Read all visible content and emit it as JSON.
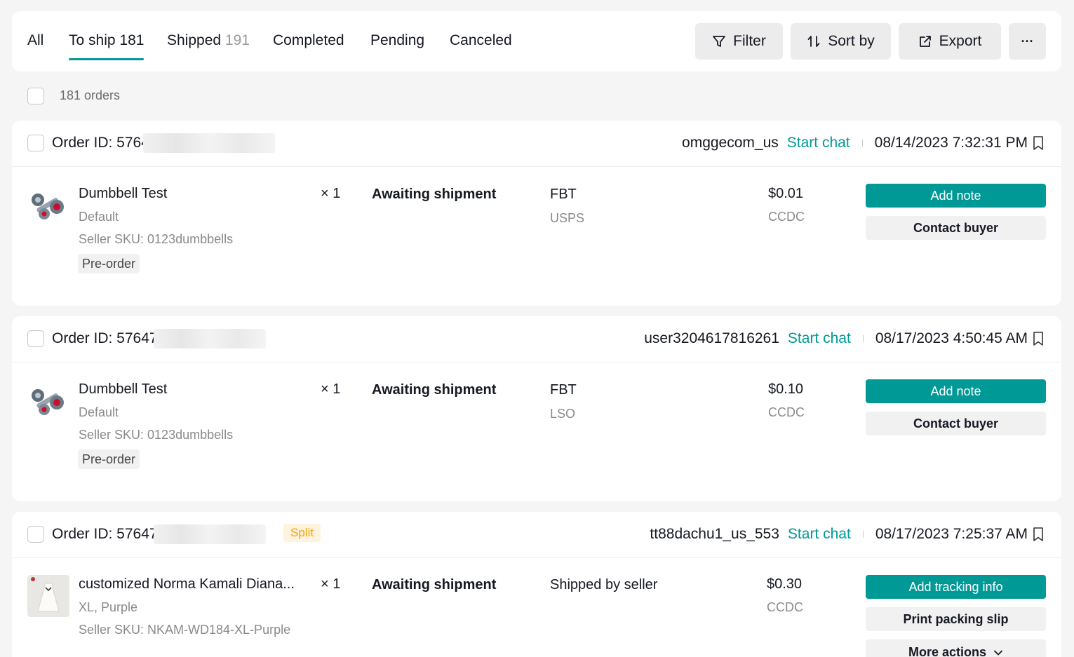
{
  "tabs": [
    {
      "label": "All",
      "count": ""
    },
    {
      "label": "To ship",
      "count": "181"
    },
    {
      "label": "Shipped",
      "count": "191"
    },
    {
      "label": "Completed",
      "count": ""
    },
    {
      "label": "Pending",
      "count": ""
    },
    {
      "label": "Canceled",
      "count": ""
    }
  ],
  "toolbar": {
    "filter_label": "Filter",
    "sort_label": "Sort by",
    "export_label": "Export",
    "more_label": "···"
  },
  "selection": {
    "orders_count": "181 orders"
  },
  "orders": [
    {
      "order_id": "Order ID: 5764",
      "buyer": "omggecom_us",
      "chat_label": "Start chat",
      "datetime": "08/14/2023 7:32:31 PM",
      "badge": "",
      "product": {
        "name": "Dumbbell Test",
        "variant": "Default",
        "sku": "Seller SKU: 0123dumbbells",
        "tag": "Pre-order",
        "qty": "× 1"
      },
      "status": "Awaiting shipment",
      "shipping": "FBT",
      "carrier": "USPS",
      "price": "$0.01",
      "payment": "CCDC",
      "actions": [
        "Add note",
        "Contact buyer"
      ]
    },
    {
      "order_id": "Order ID: 57647",
      "buyer": "user3204617816261",
      "chat_label": "Start chat",
      "datetime": "08/17/2023 4:50:45 AM",
      "badge": "",
      "product": {
        "name": "Dumbbell Test",
        "variant": "Default",
        "sku": "Seller SKU: 0123dumbbells",
        "tag": "Pre-order",
        "qty": "× 1"
      },
      "status": "Awaiting shipment",
      "shipping": "FBT",
      "carrier": "LSO",
      "price": "$0.10",
      "payment": "CCDC",
      "actions": [
        "Add note",
        "Contact buyer"
      ]
    },
    {
      "order_id": "Order ID: 57647",
      "buyer": "tt88dachu1_us_553",
      "chat_label": "Start chat",
      "datetime": "08/17/2023 7:25:37 AM",
      "badge": "Split",
      "product": {
        "name": "customized Norma Kamali Diana...",
        "variant": "XL, Purple",
        "sku": "Seller SKU: NKAM-WD184-XL-Purple",
        "tag": "",
        "qty": "× 1"
      },
      "status": "Awaiting shipment",
      "shipping": "Shipped by seller",
      "carrier": "",
      "price": "$0.30",
      "payment": "CCDC",
      "actions": [
        "Add tracking info",
        "Print packing slip",
        "More actions"
      ]
    }
  ],
  "colors": {
    "accent": "#009995",
    "badge_text": "#f2a20e",
    "badge_bg": "#fff3dd",
    "background": "#f5f5f5"
  },
  "icons": [
    "filter-icon",
    "sort-icon",
    "export-icon",
    "more-icon",
    "bookmark-icon",
    "chevron-down-icon",
    "dumbbell-image",
    "dress-image"
  ]
}
